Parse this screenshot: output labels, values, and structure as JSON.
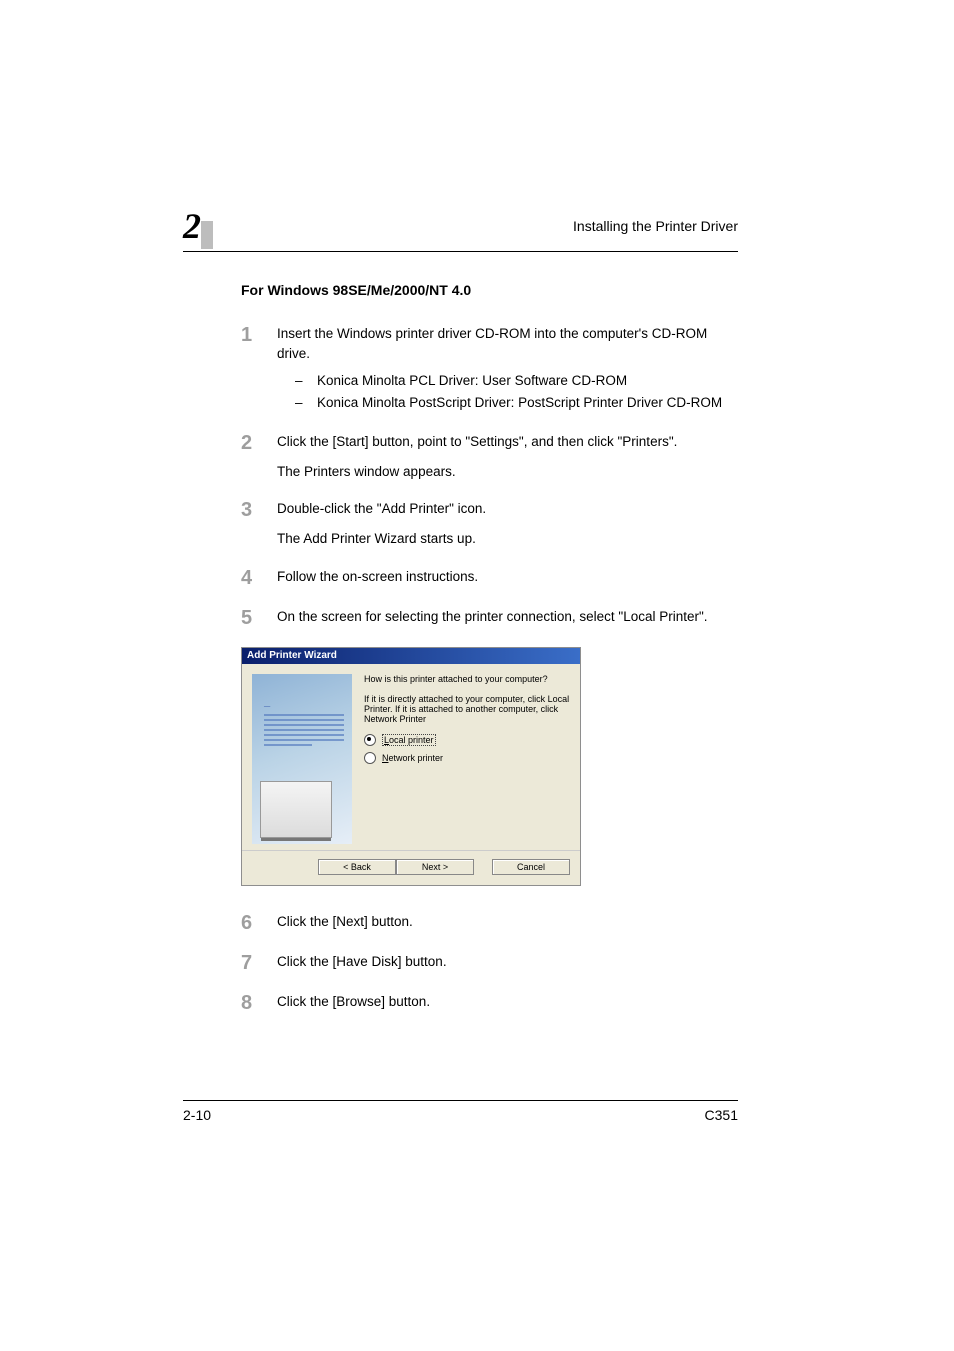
{
  "header": {
    "chapter_number": "2",
    "title": "Installing the Printer Driver"
  },
  "section_title": "For Windows 98SE/Me/2000/NT 4.0",
  "steps": [
    {
      "num": "1",
      "text": "Insert the Windows printer driver CD-ROM into the computer's CD-ROM drive.",
      "sub": [
        "Konica Minolta PCL Driver: User Software CD-ROM",
        "Konica Minolta PostScript Driver: PostScript Printer Driver CD-ROM"
      ]
    },
    {
      "num": "2",
      "text": "Click the [Start] button, point to \"Settings\", and then click \"Printers\".",
      "after": "The Printers window appears."
    },
    {
      "num": "3",
      "text": "Double-click the \"Add Printer\" icon.",
      "after": "The Add Printer Wizard starts up."
    },
    {
      "num": "4",
      "text": "Follow the on-screen instructions."
    },
    {
      "num": "5",
      "text": "On the screen for selecting the printer connection, select \"Local Printer\"."
    }
  ],
  "wizard": {
    "title": "Add Printer Wizard",
    "question": "How is this printer attached to your computer?",
    "description": "If it is directly attached to your computer, click Local Printer. If it is attached to another computer, click Network Printer",
    "options": {
      "local": {
        "label_pre": "L",
        "label_rest": "ocal printer",
        "selected": true
      },
      "network": {
        "label_pre": "N",
        "label_rest": "etwork printer",
        "selected": false
      }
    },
    "buttons": {
      "back": "< Back",
      "next": "Next >",
      "cancel": "Cancel"
    }
  },
  "steps_after": [
    {
      "num": "6",
      "text": "Click the [Next] button."
    },
    {
      "num": "7",
      "text": "Click the [Have Disk] button."
    },
    {
      "num": "8",
      "text": "Click the [Browse] button."
    }
  ],
  "footer": {
    "page": "2-10",
    "model": "C351"
  }
}
